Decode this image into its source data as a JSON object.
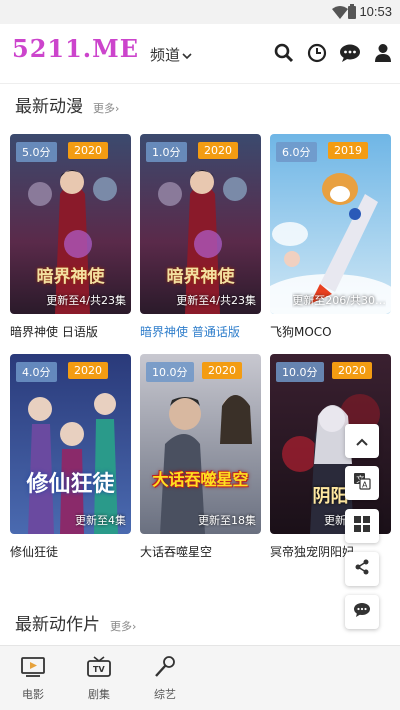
{
  "status_bar": {
    "time": "10:53"
  },
  "header": {
    "logo": "5211.ME",
    "channel_label": "频道",
    "icons": [
      "search-icon",
      "history-icon",
      "message-icon",
      "user-icon"
    ]
  },
  "sections": [
    {
      "title": "最新动漫",
      "more": "更多›"
    },
    {
      "title": "最新动作片",
      "more": "更多›"
    }
  ],
  "cards": [
    {
      "score": "5.0分",
      "year": "2020",
      "episode": "更新至4/共23集",
      "title": "暗界神使 日语版",
      "poster_text": "暗界神使"
    },
    {
      "score": "1.0分",
      "year": "2020",
      "episode": "更新至4/共23集",
      "title": "暗界神使 普通话版",
      "poster_text": "暗界神使"
    },
    {
      "score": "6.0分",
      "year": "2019",
      "episode": "更新至206/共30…",
      "title": "飞狗MOCO",
      "poster_text": ""
    },
    {
      "score": "4.0分",
      "year": "2020",
      "episode": "更新至4集",
      "title": "修仙狂徒",
      "poster_text": "修仙狂徒"
    },
    {
      "score": "10.0分",
      "year": "2020",
      "episode": "更新至18集",
      "title": "大话吞噬星空",
      "poster_text": "大话吞噬星空"
    },
    {
      "score": "10.0分",
      "year": "2020",
      "episode": "更新",
      "title": "冥帝独宠阴阳妃",
      "poster_text": "阴阳"
    }
  ],
  "floating": [
    "scroll-top-icon",
    "translate-icon",
    "windows-icon",
    "share-icon",
    "chat-icon"
  ],
  "bottom_nav": [
    {
      "label": "电影",
      "icon": "movie-icon"
    },
    {
      "label": "剧集",
      "icon": "tv-icon"
    },
    {
      "label": "综艺",
      "icon": "microphone-icon"
    }
  ]
}
